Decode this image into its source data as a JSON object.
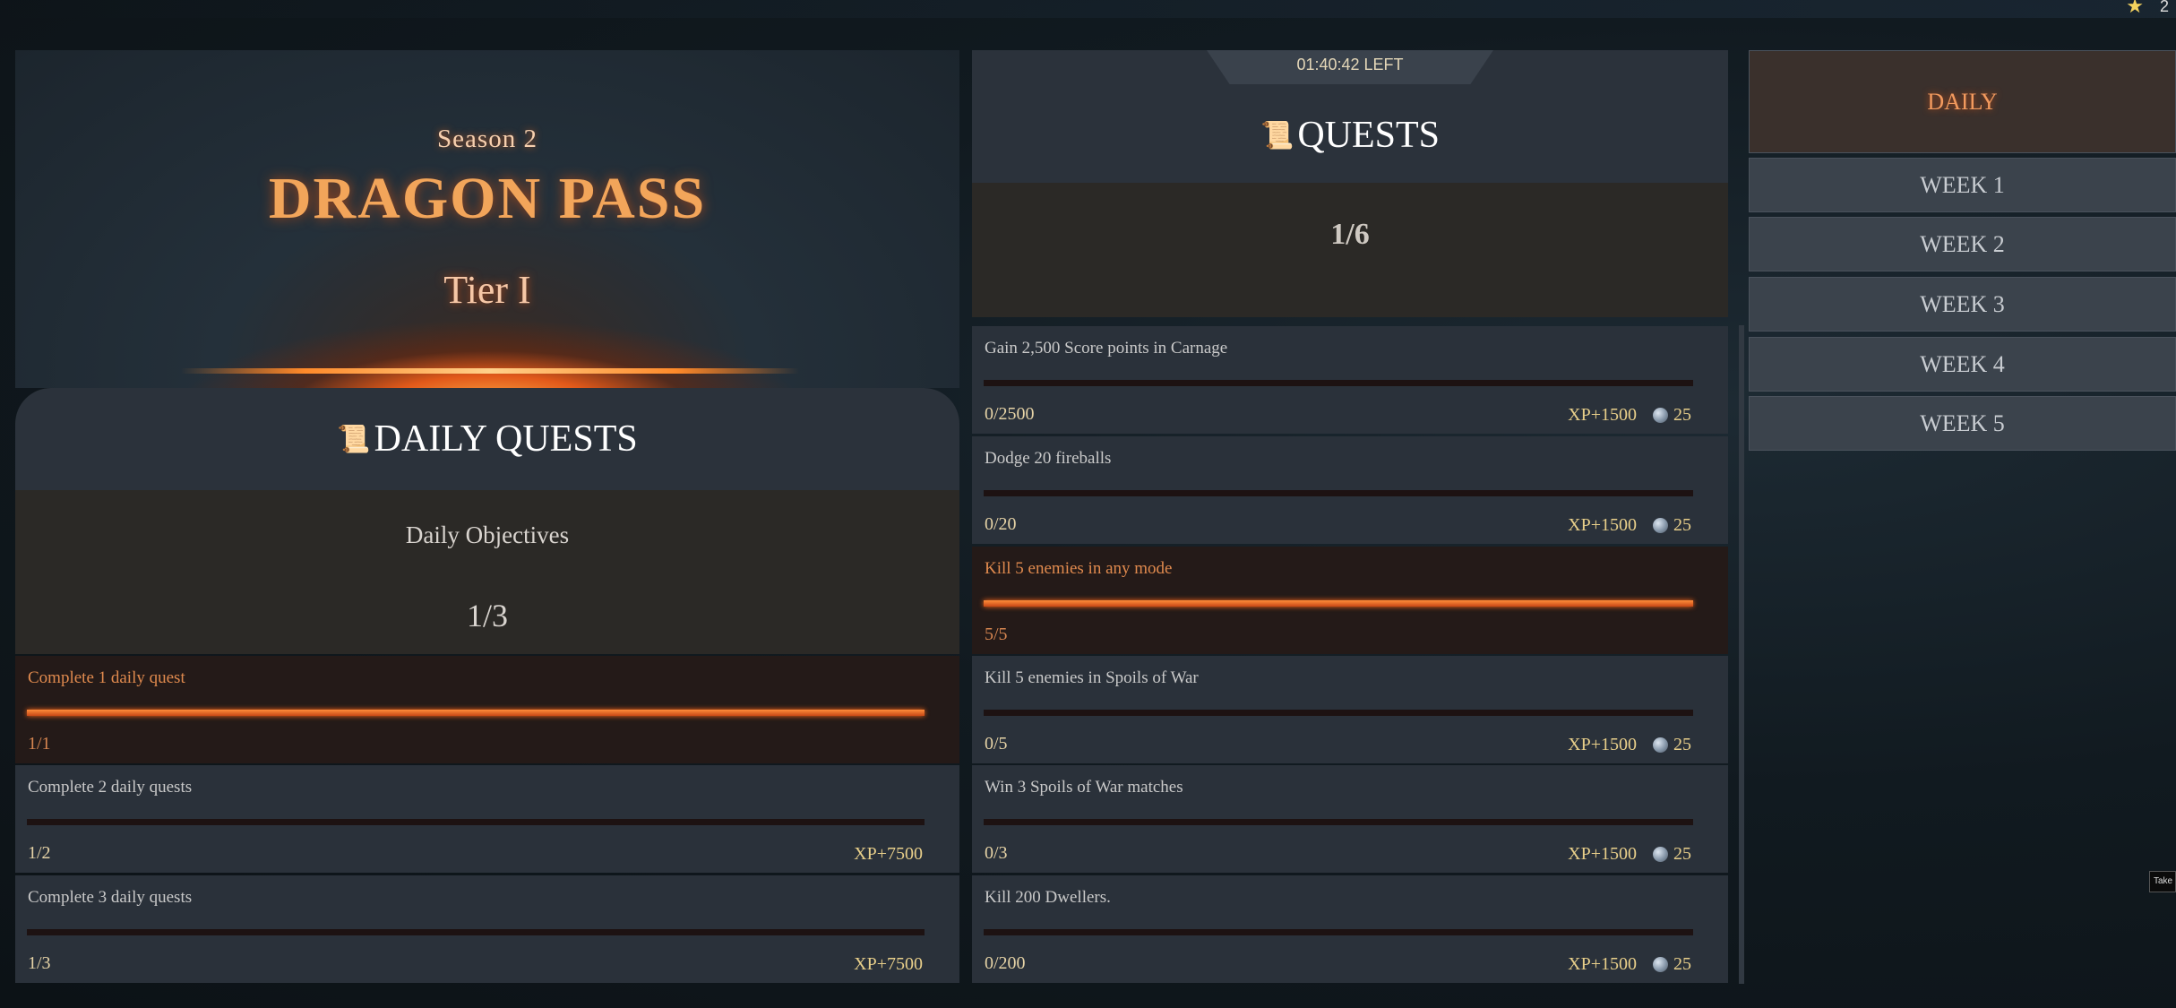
{
  "topbar": {
    "star_count": "2"
  },
  "hero": {
    "season": "Season 2",
    "title": "DRAGON PASS",
    "tier": "Tier I"
  },
  "daily": {
    "title": "DAILY QUESTS",
    "objectives_label": "Daily Objectives",
    "objectives_progress": "1/3",
    "quests": [
      {
        "name": "Complete 1 daily quest",
        "progress": "1/1",
        "reward_xp": "",
        "completed": true,
        "fill": 1.0
      },
      {
        "name": "Complete 2 daily quests",
        "progress": "1/2",
        "reward_xp": "XP+7500",
        "completed": false,
        "fill": 0
      },
      {
        "name": "Complete 3 daily quests",
        "progress": "1/3",
        "reward_xp": "XP+7500",
        "completed": false,
        "fill": 0
      }
    ]
  },
  "quests": {
    "timer": "01:40:42 LEFT",
    "title": "QUESTS",
    "progress": "1/6",
    "items": [
      {
        "name": "Gain 2,500 Score points in Carnage",
        "progress": "0/2500",
        "reward_xp": "XP+1500",
        "reward_coins": "25",
        "completed": false,
        "fill": 0
      },
      {
        "name": "Dodge 20 fireballs",
        "progress": "0/20",
        "reward_xp": "XP+1500",
        "reward_coins": "25",
        "completed": false,
        "fill": 0
      },
      {
        "name": "Kill 5 enemies in any mode",
        "progress": "5/5",
        "reward_xp": "",
        "reward_coins": "",
        "completed": true,
        "fill": 1.0
      },
      {
        "name": "Kill 5 enemies in Spoils of War",
        "progress": "0/5",
        "reward_xp": "XP+1500",
        "reward_coins": "25",
        "completed": false,
        "fill": 0
      },
      {
        "name": "Win 3 Spoils of War matches",
        "progress": "0/3",
        "reward_xp": "XP+1500",
        "reward_coins": "25",
        "completed": false,
        "fill": 0
      },
      {
        "name": "Kill 200 Dwellers.",
        "progress": "0/200",
        "reward_xp": "XP+1500",
        "reward_coins": "25",
        "completed": false,
        "fill": 0
      }
    ]
  },
  "tabs": {
    "items": [
      {
        "label": "DAILY",
        "active": true
      },
      {
        "label": "WEEK 1",
        "active": false
      },
      {
        "label": "WEEK 2",
        "active": false
      },
      {
        "label": "WEEK 3",
        "active": false
      },
      {
        "label": "WEEK 4",
        "active": false
      },
      {
        "label": "WEEK 5",
        "active": false
      }
    ]
  },
  "edge_tooltip": "Take",
  "icons": {
    "scroll": "scroll-icon",
    "coin": "coin-icon",
    "star": "star-icon"
  },
  "colors": {
    "accent": "#f29a5e",
    "progress": "#ff8c3a",
    "panel": "#2a313a",
    "completed_row": "#241a18"
  }
}
